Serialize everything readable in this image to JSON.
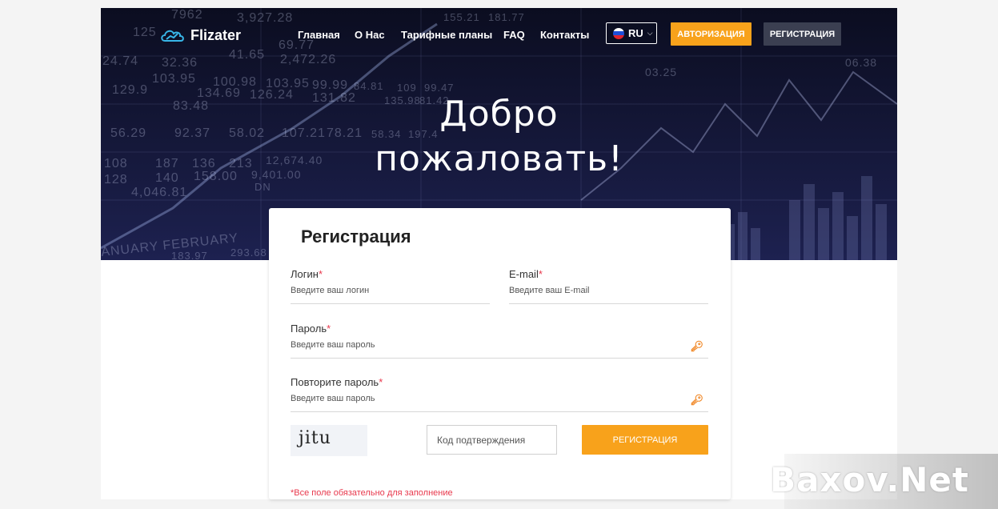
{
  "brand": {
    "name": "Flizater",
    "logo_icon": "cloud-chart-logo"
  },
  "nav": {
    "items": [
      "Главная",
      "О Нас",
      "Тарифные планы",
      "FAQ",
      "Контакты"
    ]
  },
  "lang": {
    "code": "RU",
    "icon": "russia-flag-icon"
  },
  "buttons": {
    "login": "АВТОРИЗАЦИЯ",
    "register": "РЕГИСТРАЦИЯ"
  },
  "hero": {
    "line1": "Добро",
    "line2": "пожаловать!"
  },
  "form": {
    "title": "Регистрация",
    "login": {
      "label": "Логин",
      "placeholder": "Введите ваш логин"
    },
    "email": {
      "label": "E-mail",
      "placeholder": "Введите ваш E-mail"
    },
    "password": {
      "label": "Пароль",
      "placeholder": "Введите ваш пароль"
    },
    "password_repeat": {
      "label": "Повторите пароль",
      "placeholder": "Введите ваш пароль"
    },
    "required_mark": "*",
    "captcha_text": "jitu",
    "code_placeholder": "Код подтверждения",
    "submit": "РЕГИСТРАЦИЯ",
    "required_note": "*Все поле обязательно для заполнение"
  },
  "background_numbers": [
    "125",
    "24.74",
    "32.36",
    "41.65",
    "2,472.26",
    "69.77",
    "103.95",
    "100.98",
    "103.95",
    "99.99",
    "84.81",
    "109",
    "99.47",
    "129.9",
    "134.69",
    "126.24",
    "131.82",
    "135.98",
    "81.42",
    "83.48",
    "56.29",
    "92.37",
    "58.02",
    "107.21",
    "78.21",
    "58.34",
    "197.4",
    "108",
    "187",
    "136",
    "213",
    "12,674.40",
    "128",
    "140",
    "158.00",
    "9,401.00",
    "4,046.81",
    "DN",
    "ANUARY FEBRUARY",
    "183.97",
    "293.68",
    "155.21",
    "181.77",
    "7962",
    "3,927.28",
    "03.25",
    "06.38"
  ],
  "watermark": "Baxov.Net",
  "colors": {
    "accent": "#f8a21b",
    "required": "#e8394d",
    "hero_bg": "#15183a",
    "dark_button": "#3b3f51"
  }
}
